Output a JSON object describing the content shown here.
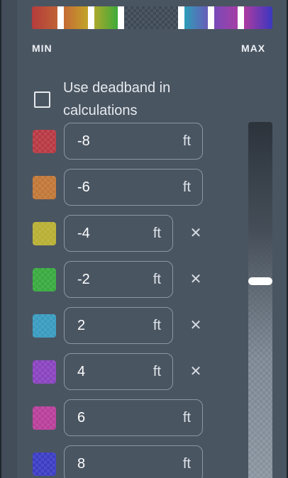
{
  "scale": {
    "min_label": "MIN",
    "max_label": "MAX",
    "colors": [
      "#b43c3c",
      "#c46e34",
      "#c2a828",
      "#3aaa3a",
      "#2aa0b8",
      "#7a4ab8",
      "#b03aa0",
      "#3a38c0"
    ]
  },
  "deadband": {
    "label": "Use deadband in calculations",
    "checked": false
  },
  "thresholds": [
    {
      "value": "-8",
      "unit": "ft",
      "color": "#b83a44",
      "removable": false
    },
    {
      "value": "-6",
      "unit": "ft",
      "color": "#c27838",
      "removable": false
    },
    {
      "value": "-4",
      "unit": "ft",
      "color": "#b8b034",
      "removable": true,
      "remove_glyph": "✕"
    },
    {
      "value": "-2",
      "unit": "ft",
      "color": "#3aaa40",
      "removable": true,
      "remove_glyph": "✕"
    },
    {
      "value": "2",
      "unit": "ft",
      "color": "#3a9cc0",
      "removable": true,
      "remove_glyph": "✕"
    },
    {
      "value": "4",
      "unit": "ft",
      "color": "#8a44c0",
      "removable": true,
      "remove_glyph": "✕"
    },
    {
      "value": "6",
      "unit": "ft",
      "color": "#b8409a",
      "removable": false
    },
    {
      "value": "8",
      "unit": "ft",
      "color": "#3c3ec4",
      "removable": false
    }
  ],
  "opacity_slider": {
    "level": 0.56
  }
}
